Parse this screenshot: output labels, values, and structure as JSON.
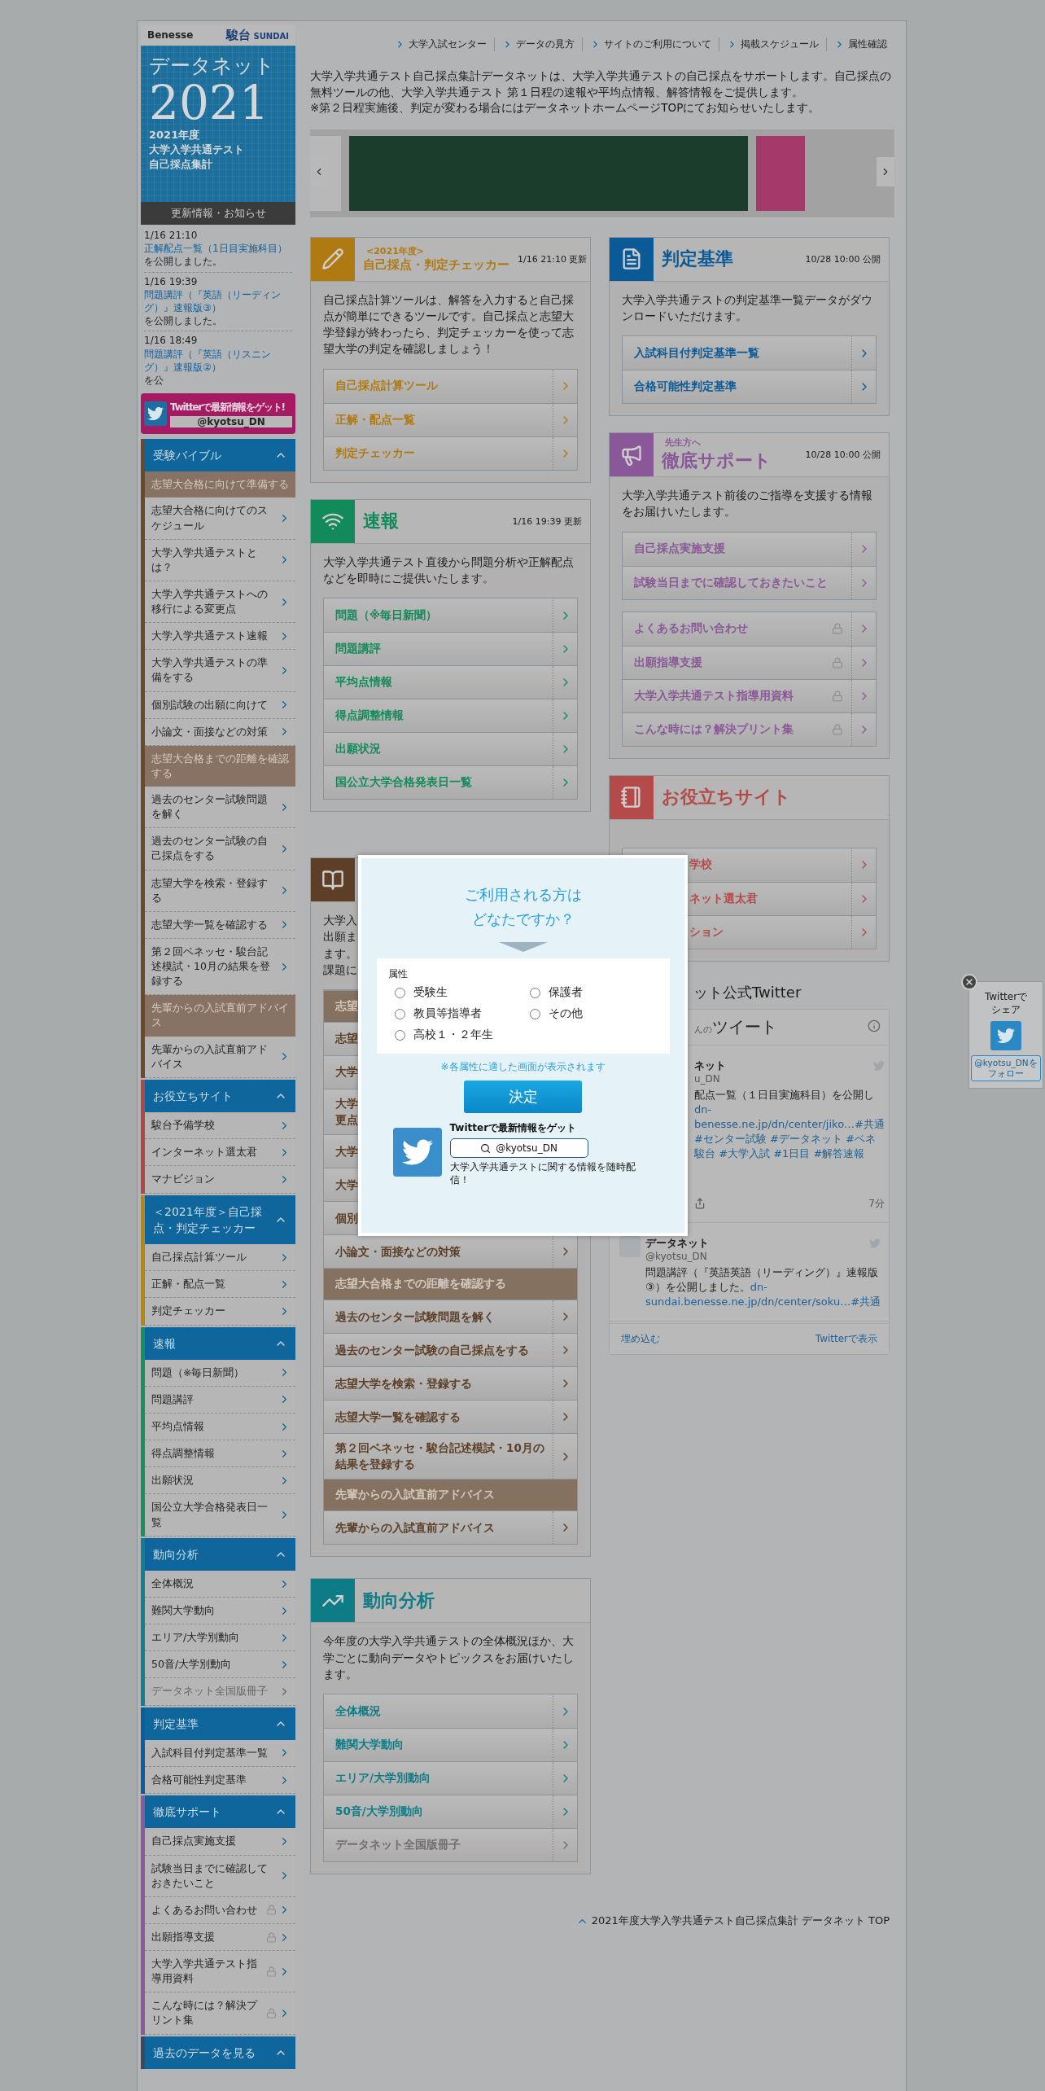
{
  "header": {
    "logo_left": "Benesse",
    "logo_right": "駿台",
    "logo_right_sub": "SUNDAI",
    "nav": [
      "大学入試センター",
      "データの見方",
      "サイトのご利用について",
      "掲載スケジュール",
      "属性確認"
    ]
  },
  "sidebar": {
    "brand": {
      "title": "データネット",
      "year": "2021",
      "lines": [
        "2021年度",
        "大学入学共通テスト",
        "自己採点集計"
      ]
    },
    "news_title": "更新情報・お知らせ",
    "news": [
      {
        "time": "1/16 21:10",
        "link": "正解配点一覧（1日目実施科目）",
        "after": "を公開しました。"
      },
      {
        "time": "1/16 19:39",
        "link": "問題講評（『英語（リーディング）』速報版③）",
        "after": "を公開しました。"
      },
      {
        "time": "1/16 18:49",
        "link": "問題講評（『英語（リスニング）』速報版②）",
        "after": "を公"
      }
    ],
    "twitter_banner": {
      "text": "Twitterで最新情報をゲット!",
      "handle": "@kyotsu_DN"
    },
    "groups": [
      {
        "title": "受験バイブル",
        "color": "#6b4a2b",
        "expanded": true,
        "items": [
          {
            "kind": "section",
            "label": "志望大合格に向けて準備する"
          },
          {
            "kind": "link",
            "label": "志望大合格に向けてのスケジュール"
          },
          {
            "kind": "link",
            "label": "大学入学共通テストとは？"
          },
          {
            "kind": "link",
            "label": "大学入学共通テストへの移行による変更点"
          },
          {
            "kind": "link",
            "label": "大学入学共通テスト速報"
          },
          {
            "kind": "link",
            "label": "大学入学共通テストの準備をする"
          },
          {
            "kind": "link",
            "label": "個別試験の出願に向けて"
          },
          {
            "kind": "link",
            "label": "小論文・面接などの対策"
          },
          {
            "kind": "section",
            "label": "志望大合格までの距離を確認する"
          },
          {
            "kind": "link",
            "label": "過去のセンター試験問題を解く"
          },
          {
            "kind": "link",
            "label": "過去のセンター試験の自己採点をする"
          },
          {
            "kind": "link",
            "label": "志望大学を検索・登録する"
          },
          {
            "kind": "link",
            "label": "志望大学一覧を確認する"
          },
          {
            "kind": "link",
            "label": "第２回ベネッセ・駿台記述模試・10月の結果を登録する"
          },
          {
            "kind": "section",
            "label": "先輩からの入試直前アドバイス"
          },
          {
            "kind": "link",
            "label": "先輩からの入試直前アドバイス"
          }
        ]
      },
      {
        "title": "お役立ちサイト",
        "color": "#b04848",
        "expanded": true,
        "items": [
          {
            "kind": "link",
            "label": "駿台予備学校"
          },
          {
            "kind": "link",
            "label": "インターネット選太君"
          },
          {
            "kind": "link",
            "label": "マナビジョン"
          }
        ]
      },
      {
        "title": "＜2021年度＞自己採点・判定チェッカー",
        "color": "#b8860b",
        "expanded": true,
        "items": [
          {
            "kind": "link",
            "label": "自己採点計算ツール"
          },
          {
            "kind": "link",
            "label": "正解・配点一覧"
          },
          {
            "kind": "link",
            "label": "判定チェッカー"
          }
        ]
      },
      {
        "title": "速報",
        "color": "#15905e",
        "expanded": true,
        "items": [
          {
            "kind": "link",
            "label": "問題（※毎日新聞）"
          },
          {
            "kind": "link",
            "label": "問題講評"
          },
          {
            "kind": "link",
            "label": "平均点情報"
          },
          {
            "kind": "link",
            "label": "得点調整情報"
          },
          {
            "kind": "link",
            "label": "出願状況"
          },
          {
            "kind": "link",
            "label": "国公立大学合格発表日一覧"
          }
        ]
      },
      {
        "title": "動向分析",
        "color": "#127f8c",
        "expanded": true,
        "items": [
          {
            "kind": "link",
            "label": "全体概況"
          },
          {
            "kind": "link",
            "label": "難関大学動向"
          },
          {
            "kind": "link",
            "label": "エリア/大学別動向"
          },
          {
            "kind": "link",
            "label": "50音/大学別動向"
          },
          {
            "kind": "muted",
            "label": "データネット全国版冊子"
          }
        ]
      },
      {
        "title": "判定基準",
        "color": "#0d5d9c",
        "expanded": true,
        "items": [
          {
            "kind": "link",
            "label": "入試科目付判定基準一覧"
          },
          {
            "kind": "link",
            "label": "合格可能性判定基準"
          }
        ]
      },
      {
        "title": "徹底サポート",
        "color": "#8a5a9c",
        "expanded": true,
        "items": [
          {
            "kind": "link",
            "label": "自己採点実施支援"
          },
          {
            "kind": "link",
            "label": "試験当日までに確認しておきたいこと"
          },
          {
            "kind": "locked",
            "label": "よくあるお問い合わせ"
          },
          {
            "kind": "locked",
            "label": "出願指導支援"
          },
          {
            "kind": "locked",
            "label": "大学入学共通テスト指導用資料"
          },
          {
            "kind": "locked",
            "label": "こんな時には？解決プリント集"
          }
        ]
      },
      {
        "title": "過去のデータを見る",
        "color": "#3a4a5a",
        "expanded": true
      }
    ]
  },
  "intro": {
    "text": "大学入学共通テスト自己採点集計データネットは、大学入学共通テストの自己採点をサポートします。自己採点の無料ツールの他、大学入学共通テスト 第１日程の速報や平均点情報、解答情報をご提供します。",
    "note": "※第２日程実施後、判定が変わる場合にはデータネットホームページTOPにてお知らせいたします。"
  },
  "columns": [
    [
      {
        "color": "#b07a12",
        "kicker": "<2021年度>",
        "title": "自己採点・判定チェッカー",
        "date": "1/16 21:10 更新",
        "description": [
          "自己採点計算ツールは、解答を入力すると自己採点が簡単にできるツールです。自己採点と志望大学登録が終わったら、判定チェッカーを使って志望大学の判定を確認しましょう！"
        ],
        "groups": [
          [
            {
              "kind": "link",
              "label": "自己採点計算ツール"
            },
            {
              "kind": "link",
              "label": "正解・配点一覧"
            },
            {
              "kind": "link",
              "label": "判定チェッカー"
            }
          ]
        ]
      },
      {
        "color": "#138a5a",
        "title": "速報",
        "date": "1/16 19:39 更新",
        "description": [
          "大学入学共通テスト直後から問題分析や正解配点などを即時にご提供いたします。"
        ],
        "groups": [
          [
            {
              "kind": "link",
              "label": "問題（※毎日新聞）"
            },
            {
              "kind": "link",
              "label": "問題講評"
            },
            {
              "kind": "link",
              "label": "平均点情報"
            },
            {
              "kind": "link",
              "label": "得点調整情報"
            },
            {
              "kind": "link",
              "label": "出願状況"
            },
            {
              "kind": "link",
              "label": "国公立大学合格発表日一覧"
            }
          ]
        ]
      },
      {
        "color": "#5c3f26",
        "description": [
          "大学入",
          "出願ま",
          "ます。",
          "課題に"
        ],
        "groups": [
          [
            {
              "kind": "section",
              "label": "志望"
            },
            {
              "kind": "cut",
              "label": "志望"
            },
            {
              "kind": "cut",
              "label": "大学"
            },
            {
              "kind": "cut",
              "lines": [
                "大学",
                "更点"
              ]
            },
            {
              "kind": "cut",
              "label": "大学"
            },
            {
              "kind": "cut",
              "label": "大学"
            },
            {
              "kind": "cut",
              "label": "個別"
            },
            {
              "kind": "link",
              "label": "小論文・面接などの対策"
            },
            {
              "kind": "section",
              "label": "志望大合格までの距離を確認する"
            },
            {
              "kind": "link",
              "label": "過去のセンター試験問題を解く"
            },
            {
              "kind": "link",
              "label": "過去のセンター試験の自己採点をする"
            },
            {
              "kind": "link",
              "label": "志望大学を検索・登録する"
            },
            {
              "kind": "link",
              "label": "志望大学一覧を確認する"
            },
            {
              "kind": "link",
              "label": "第２回ベネッセ・駿台記述模試・10月の結果を登録する"
            },
            {
              "kind": "section",
              "label": "先輩からの入試直前アドバイス"
            },
            {
              "kind": "link",
              "label": "先輩からの入試直前アドバイス"
            }
          ]
        ]
      },
      {
        "color": "#0e7c86",
        "title": "動向分析",
        "description": [
          "今年度の大学入学共通テストの全体概況ほか、大学ごとに動向データやトピックスをお届けいたします。"
        ],
        "groups": [
          [
            {
              "kind": "link",
              "label": "全体概況"
            },
            {
              "kind": "link",
              "label": "難関大学動向"
            },
            {
              "kind": "link",
              "label": "エリア/大学別動向"
            },
            {
              "kind": "link",
              "label": "50音/大学別動向"
            },
            {
              "kind": "muted",
              "label": "データネット全国版冊子"
            }
          ]
        ]
      }
    ],
    [
      {
        "color": "#0b5a98",
        "title": "判定基準",
        "date": "10/28 10:00 公開",
        "description": [
          "大学入学共通テストの判定基準一覧データがダウンロードいただけます。"
        ],
        "groups": [
          [
            {
              "kind": "link",
              "label": "入試科目付判定基準一覧"
            },
            {
              "kind": "link",
              "label": "合格可能性判定基準"
            }
          ]
        ]
      },
      {
        "color": "#8a5898",
        "kicker": "先生方へ",
        "title": "徹底サポート",
        "date": "10/28 10:00 公開",
        "description": [
          "大学入学共通テスト前後のご指導を支援する情報をお届けいたします。"
        ],
        "groups": [
          [
            {
              "kind": "link",
              "label": "自己採点実施支援"
            },
            {
              "kind": "link",
              "label": "試験当日までに確認しておきたいこと"
            }
          ],
          [
            {
              "kind": "locked",
              "label": "よくあるお問い合わせ"
            },
            {
              "kind": "locked",
              "label": "出願指導支援"
            },
            {
              "kind": "locked",
              "label": "大学入学共通テスト指導用資料"
            },
            {
              "kind": "locked",
              "label": "こんな時には？解決プリント集"
            }
          ]
        ]
      },
      {
        "color": "#b44a4a",
        "title": "お役立ちサイト",
        "groups": [
          [
            {
              "kind": "tail",
              "label": "学校"
            },
            {
              "kind": "tail",
              "label": "ネット選太君"
            },
            {
              "kind": "tail",
              "label": "ション"
            }
          ]
        ]
      }
    ]
  ],
  "timeline": {
    "title": "ット公式Twitter",
    "header_prefix": "んの",
    "header_title": "ツイート",
    "tweets": [
      {
        "name": "ネット",
        "handle": "u_DN",
        "lines": [
          {
            "kind": "text",
            "text": "配点一覧（１日目実施科目）を公開し"
          },
          {
            "kind": "link",
            "text": "dn-"
          },
          {
            "kind": "link",
            "text": "benesse.ne.jp/dn/center/jiko…#共通"
          },
          {
            "kind": "link",
            "text": "#センター試験 #データネット #ベネ"
          },
          {
            "kind": "link",
            "text": "駿台 #大学入試 #1日目 #解答速報"
          }
        ],
        "time": "7分"
      },
      {
        "name": "データネット",
        "handle": "@kyotsu_DN",
        "lines": [
          {
            "kind": "text",
            "text": "問題講評（『英語英語（リーディング）』速報版③）を公開しました。"
          },
          {
            "kind": "link",
            "text": "dn-"
          },
          {
            "kind": "link",
            "text": "sundai.benesse.ne.jp/dn/center/soku…#共通"
          }
        ]
      }
    ],
    "embed": "埋め込む",
    "view": "Twitterで表示"
  },
  "footer_link": "2021年度大学入学共通テスト自己採点集計 データネット TOP",
  "modal": {
    "title": "ご利用される方はどなたですか？",
    "label": "属性",
    "options": [
      {
        "label": "受験生",
        "selected": false
      },
      {
        "label": "保護者",
        "selected": false
      },
      {
        "label": "教員等指導者",
        "selected": false
      },
      {
        "label": "その他",
        "selected": false
      },
      {
        "label": "高校１・２年生",
        "selected": false
      }
    ],
    "note": "※各属性に適した画面が表示されます",
    "button": "決定",
    "twitter_title": "Twitterで最新情報をゲット",
    "handle": "@kyotsu_DN",
    "twitter_text": "大学入学共通テストに関する情報を随時配信！"
  },
  "share": {
    "title": "Twitterでシェア",
    "follow": "@kyotsu_DNをフォロー"
  }
}
